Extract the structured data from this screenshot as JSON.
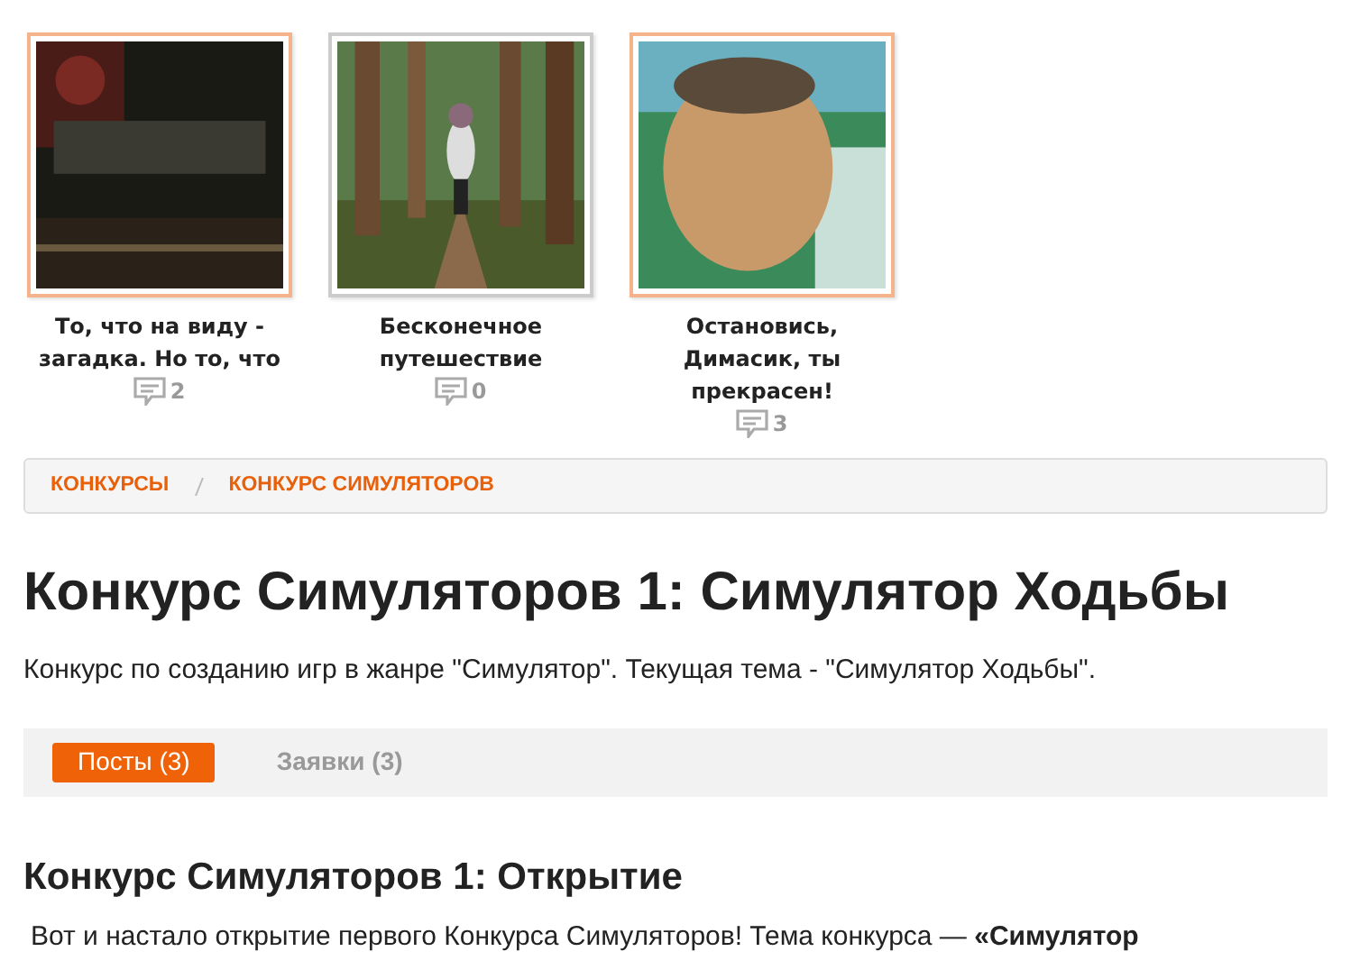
{
  "games": [
    {
      "kind": "dark",
      "highlighted": true,
      "title": "То, что на виду - загадка. Но то, что",
      "comments": "2"
    },
    {
      "kind": "forest",
      "highlighted": false,
      "title": "Бесконечное путешествие",
      "comments": "0"
    },
    {
      "kind": "portrait",
      "highlighted": true,
      "title": "Остановись, Димасик, ты прекрасен!",
      "comments": "3"
    }
  ],
  "breadcrumb": [
    "КОНКУРСЫ",
    "КОНКУРС СИМУЛЯТОРОВ"
  ],
  "title": "Конкурс Симуляторов 1: Симулятор Ходьбы",
  "description": "Конкурс по созданию игр в жанре \"Симулятор\". Текущая тема - \"Симулятор Ходьбы\".",
  "tabs": [
    {
      "label": "Посты (3)",
      "selected": true
    },
    {
      "label": "Заявки (3)",
      "selected": false
    }
  ],
  "post": {
    "title": "Конкурс Симуляторов 1: Открытие",
    "text": "Вот и настало открытие первого Конкурса Симуляторов! Тема конкурса — **«Симулятор**"
  }
}
